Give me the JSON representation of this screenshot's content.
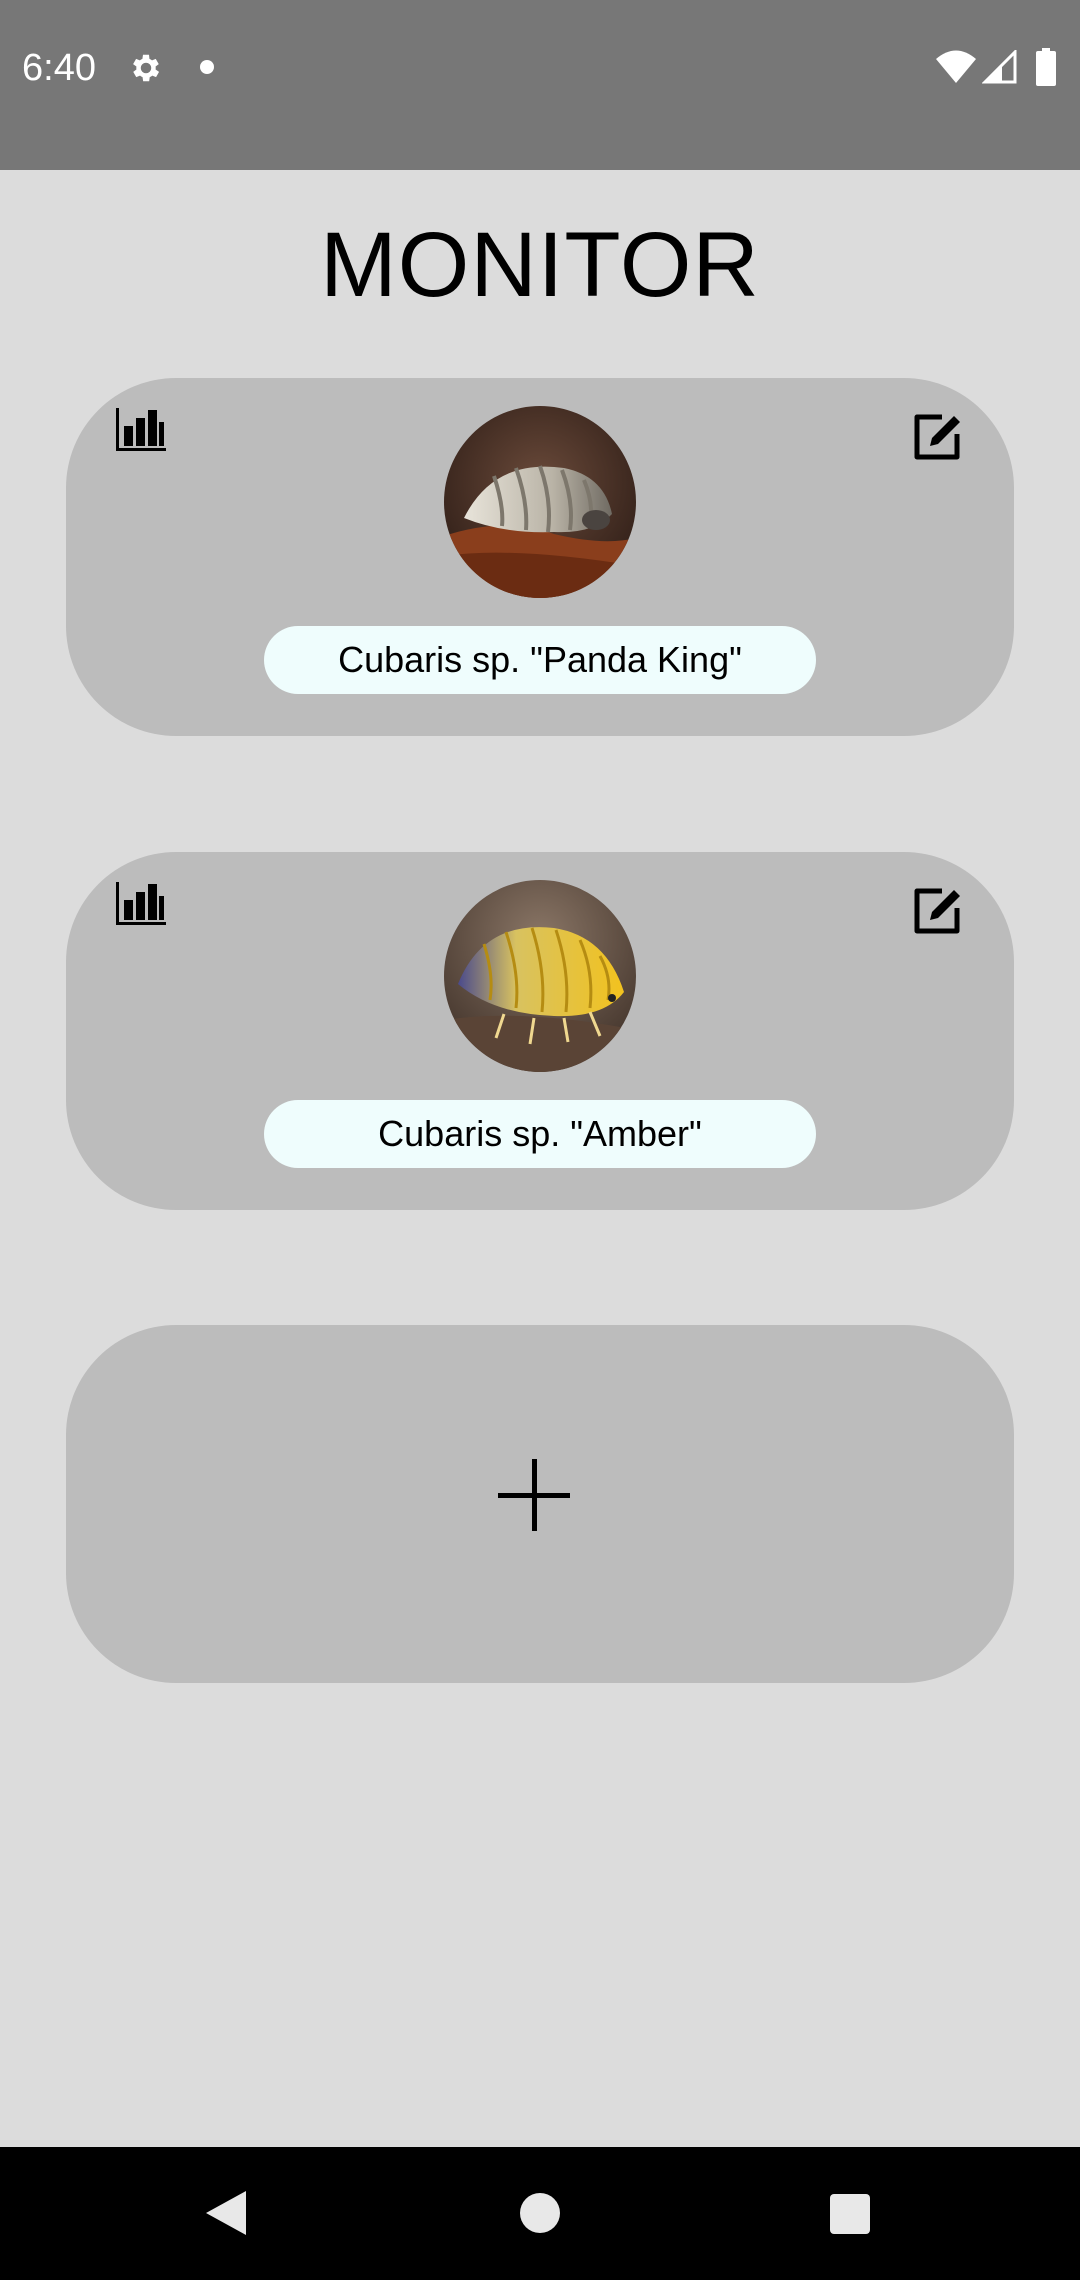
{
  "status_bar": {
    "time": "6:40",
    "icons": [
      "gear-icon",
      "notification-dot-icon",
      "wifi-icon",
      "signal-icon",
      "battery-icon"
    ]
  },
  "page": {
    "title": "MONITOR"
  },
  "cards": [
    {
      "name": "Cubaris sp. \"Panda King\"",
      "stats_icon": "bar-chart-icon",
      "edit_icon": "edit-icon",
      "avatar": "isopod-photo"
    },
    {
      "name": "Cubaris sp. \"Amber\"",
      "stats_icon": "bar-chart-icon",
      "edit_icon": "edit-icon",
      "avatar": "isopod-photo"
    }
  ],
  "add_card": {
    "icon": "plus-icon"
  },
  "nav_bar": {
    "icons": [
      "back-icon",
      "home-icon",
      "recents-icon"
    ]
  },
  "colors": {
    "background": "#dcdcdc",
    "status_bar": "#777777",
    "card": "#bcbcbc",
    "name_pill": "#effdfd",
    "nav_bar": "#000000"
  }
}
